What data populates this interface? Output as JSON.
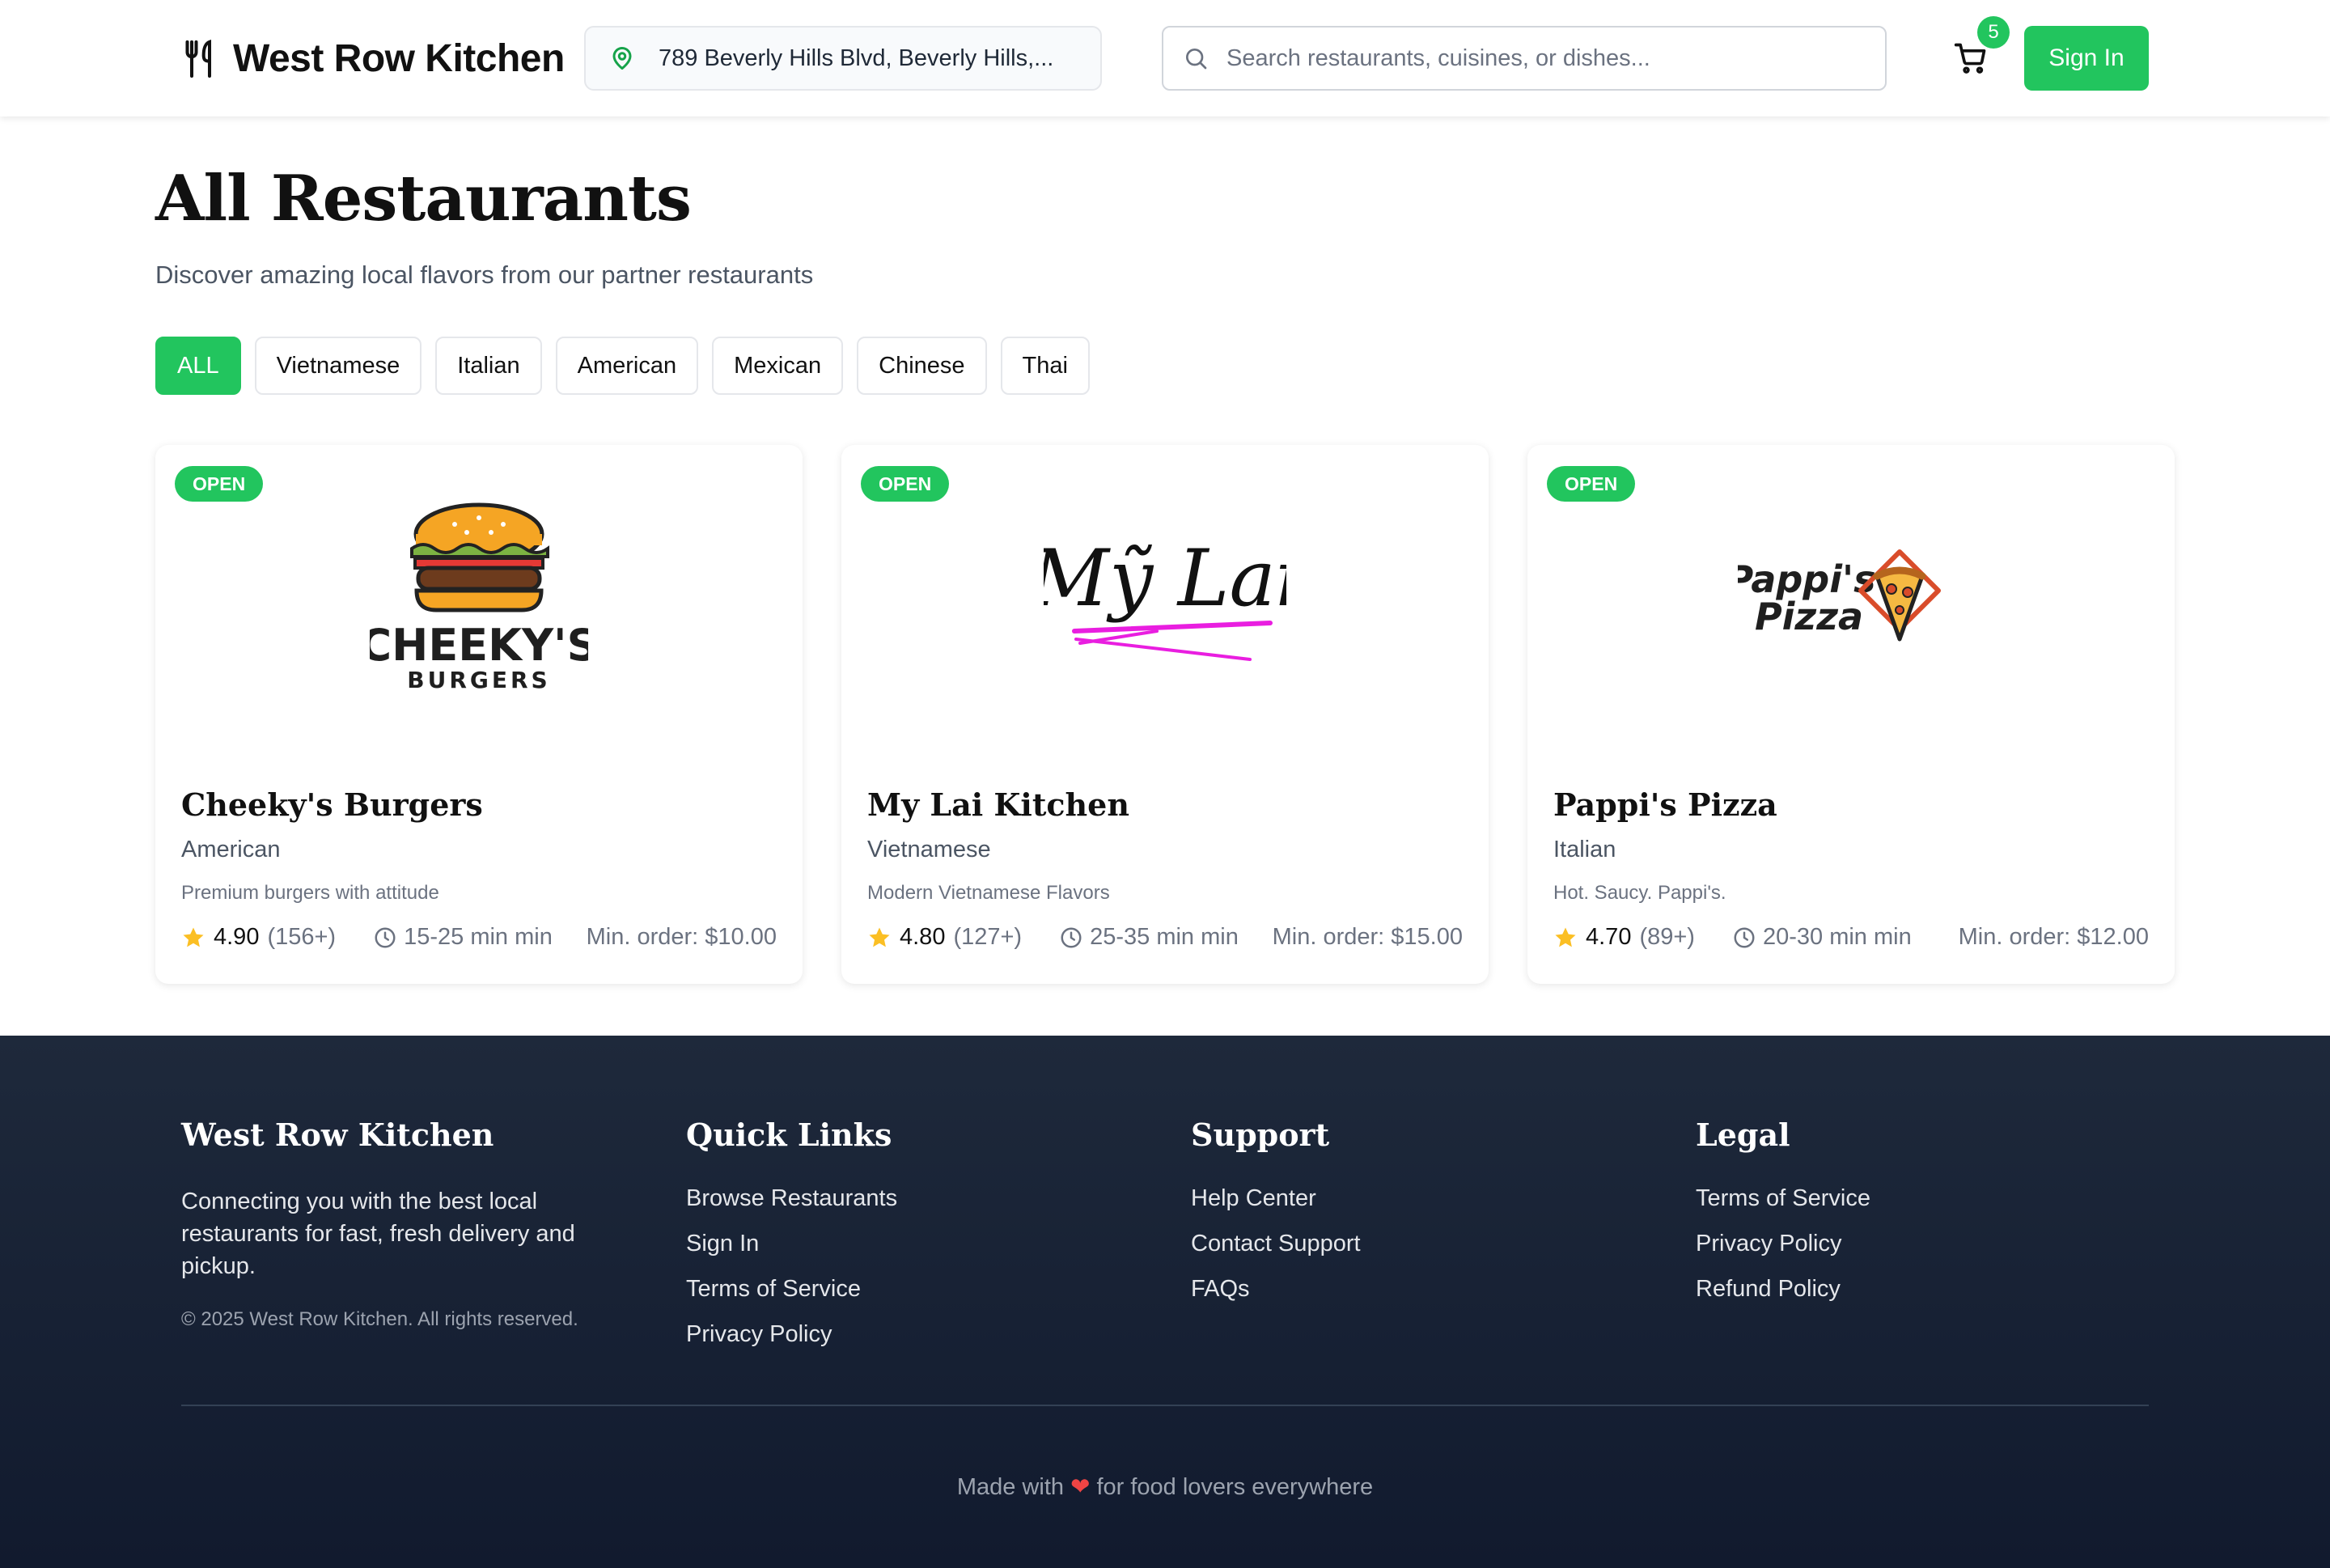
{
  "header": {
    "brand": "West Row Kitchen",
    "address": "789 Beverly Hills Blvd, Beverly Hills,...",
    "search_placeholder": "Search restaurants, cuisines, or dishes...",
    "cart_count": "5",
    "signin_label": "Sign In"
  },
  "main": {
    "title": "All Restaurants",
    "subtitle": "Discover amazing local flavors from our partner restaurants",
    "filters": [
      "ALL",
      "Vietnamese",
      "Italian",
      "American",
      "Mexican",
      "Chinese",
      "Thai"
    ],
    "active_filter": "ALL",
    "restaurants": [
      {
        "status": "OPEN",
        "logo_text": "CHEEKY'S",
        "logo_subtext": "BURGERS",
        "name": "Cheeky's Burgers",
        "cuisine": "American",
        "description": "Premium burgers with attitude",
        "rating": "4.90",
        "reviews": "(156+)",
        "eta": "15-25 min min",
        "min_order": "Min. order: $10.00"
      },
      {
        "status": "OPEN",
        "logo_text": "Mỹ Lai",
        "name": "My Lai Kitchen",
        "cuisine": "Vietnamese",
        "description": "Modern Vietnamese Flavors",
        "rating": "4.80",
        "reviews": "(127+)",
        "eta": "25-35 min min",
        "min_order": "Min. order: $15.00"
      },
      {
        "status": "OPEN",
        "logo_text": "Pappi's",
        "logo_subtext": "Pizza",
        "name": "Pappi's Pizza",
        "cuisine": "Italian",
        "description": "Hot. Saucy. Pappi's.",
        "rating": "4.70",
        "reviews": "(89+)",
        "eta": "20-30 min min",
        "min_order": "Min. order: $12.00"
      }
    ]
  },
  "footer": {
    "about": {
      "title": "West Row Kitchen",
      "description": "Connecting you with the best local restaurants for fast, fresh delivery and pickup.",
      "copyright": "© 2025 West Row Kitchen. All rights reserved."
    },
    "quick_links": {
      "title": "Quick Links",
      "items": [
        "Browse Restaurants",
        "Sign In",
        "Terms of Service",
        "Privacy Policy"
      ]
    },
    "support": {
      "title": "Support",
      "items": [
        "Help Center",
        "Contact Support",
        "FAQs"
      ]
    },
    "legal": {
      "title": "Legal",
      "items": [
        "Terms of Service",
        "Privacy Policy",
        "Refund Policy"
      ]
    },
    "bottom_before": "Made with",
    "bottom_heart": "❤",
    "bottom_after": "for food lovers everywhere"
  },
  "colors": {
    "accent": "#22c55e",
    "footer_bg": "#1e293b",
    "star": "#fbbf24"
  },
  "icons": [
    "utensils-icon",
    "map-pin-icon",
    "search-icon",
    "cart-icon",
    "star-icon",
    "clock-icon"
  ]
}
